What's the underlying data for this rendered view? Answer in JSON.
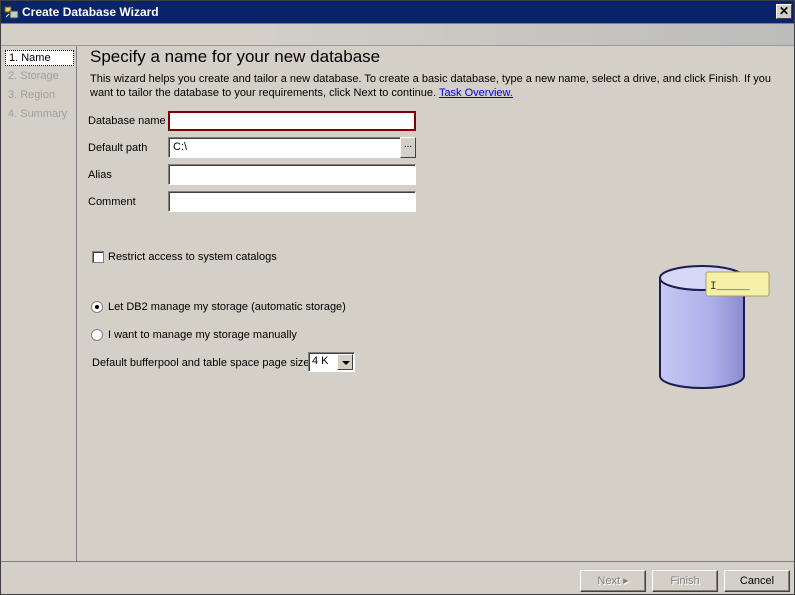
{
  "window": {
    "title": "Create Database Wizard",
    "close_glyph": "✕",
    "icon": "database-wizard-icon"
  },
  "steps": [
    {
      "label": "1. Name",
      "active": true
    },
    {
      "label": "2. Storage",
      "active": false
    },
    {
      "label": "3. Region",
      "active": false
    },
    {
      "label": "4. Summary",
      "active": false
    }
  ],
  "main": {
    "heading": "Specify a name for your new database",
    "intro": "This wizard helps you create and tailor a new database. To create a basic database, type a new name, select a drive, and click Finish. If you want to tailor the database to your requirements, click Next to continue.",
    "intro_link": "Task Overview."
  },
  "form": {
    "database_name": {
      "label": "Database name",
      "value": ""
    },
    "default_path": {
      "label": "Default path",
      "value": "C:\\",
      "browse_label": "..."
    },
    "alias": {
      "label": "Alias",
      "value": ""
    },
    "comment": {
      "label": "Comment",
      "value": ""
    }
  },
  "options": {
    "restrict_access": {
      "label": "Restrict access to system catalogs",
      "checked": false
    },
    "storage_auto": {
      "label": "Let DB2 manage my storage (automatic storage)",
      "checked": true
    },
    "storage_manual": {
      "label": "I want to manage my storage manually",
      "checked": false
    },
    "page_size": {
      "label": "Default bufferpool and table space page size",
      "value": "4 K"
    }
  },
  "graphic": {
    "tag_text": "I_____"
  },
  "footer": {
    "next_label": "Next ▸",
    "finish_label": "Finish",
    "cancel_label": "Cancel"
  },
  "colors": {
    "titlebar": "#0a246a",
    "focused_border": "#800000",
    "cylinder": "#b6b8ee",
    "tag": "#f5f0a8",
    "link": "#0000ee"
  }
}
